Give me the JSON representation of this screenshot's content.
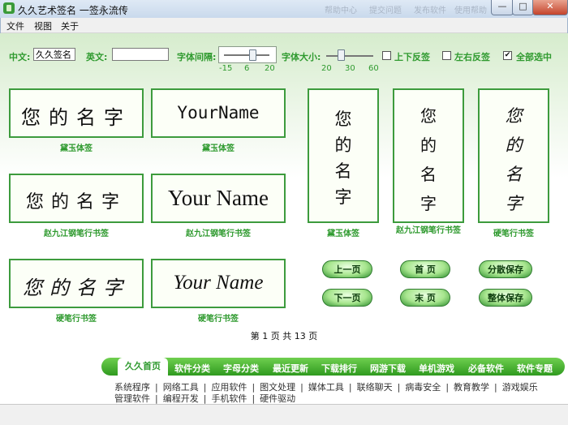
{
  "window": {
    "title": "久久艺术签名 一签永流传",
    "faded_title_parts": [
      "帮助中心",
      "提交问题",
      "发布软件",
      "使用帮助"
    ]
  },
  "menu": [
    "文件",
    "视图",
    "关于"
  ],
  "controls": {
    "chinese_label": "中文:",
    "chinese_value": "久久签名",
    "english_label": "英文:",
    "english_value": "",
    "spacing_label": "字体间隔:",
    "spacing_ticks": [
      "-15",
      "6",
      "20"
    ],
    "spacing_value": 6,
    "size_label": "字体大小:",
    "size_ticks": [
      "20",
      "30",
      "60"
    ],
    "size_value": 20,
    "flip_vertical_label": "上下反签",
    "flip_vertical_checked": false,
    "flip_horizontal_label": "左右反签",
    "flip_horizontal_checked": false,
    "select_all_label": "全部选中",
    "select_all_checked": true
  },
  "cards": [
    {
      "text": "您的名字",
      "caption": "黛玉体签"
    },
    {
      "text": "YourName",
      "caption": "黛玉体签"
    },
    {
      "text": "您的名字",
      "caption": "赵九江钢笔行书签"
    },
    {
      "text": "Your Name",
      "caption": "赵九江钢笔行书签"
    },
    {
      "text": "您的名字",
      "caption": "硬笔行书签"
    },
    {
      "text": "Your Name",
      "caption": "硬笔行书签"
    }
  ],
  "vertical_cards": [
    {
      "chars": [
        "您",
        "的",
        "名",
        "字"
      ],
      "caption": "黛玉体签"
    },
    {
      "chars": [
        "您",
        "的",
        "名",
        "字"
      ],
      "caption": "赵九江钢笔行书签"
    },
    {
      "chars": [
        "您",
        "的",
        "名",
        "字"
      ],
      "caption": "硬笔行书签"
    }
  ],
  "buttons": {
    "prev": "上一页",
    "first": "首 页",
    "save_split": "分散保存",
    "next": "下一页",
    "last": "末 页",
    "save_whole": "整体保存"
  },
  "page_info": "第 1 页 共 13 页",
  "nav": {
    "home": "久久首页",
    "items": [
      "软件分类",
      "字母分类",
      "最近更新",
      "下载排行",
      "网游下载",
      "单机游戏",
      "必备软件",
      "软件专题"
    ]
  },
  "links_row1": [
    "系统程序",
    "网络工具",
    "应用软件",
    "图文处理",
    "媒体工具",
    "联络聊天",
    "病毒安全",
    "教育教学",
    "游戏娱乐"
  ],
  "links_row2": [
    "管理软件",
    "编程开发",
    "手机软件",
    "硬件驱动"
  ],
  "link_separator": "|"
}
